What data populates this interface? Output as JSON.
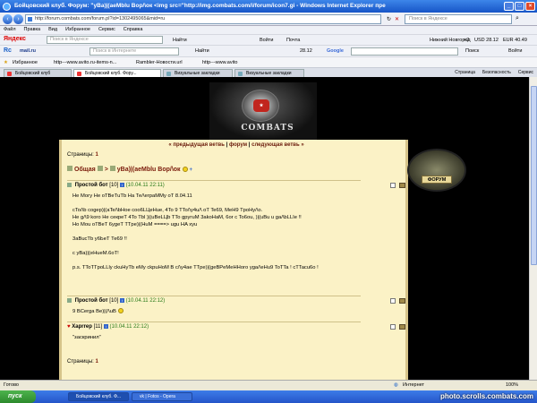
{
  "window": {
    "title": "Бойцовский клуб. Форум: \"уВа)|(аеМblu Вор/\\ок <img src=\"http://img.combats.com/i/forum/icon7.gi - Windows Internet Explorer пре"
  },
  "address": {
    "url": "http://forum.combats.com/forum.pl?id=1302495065&mid=ru",
    "search_placeholder": "Поиск в Яндексе"
  },
  "menu": [
    "Файл",
    "Правка",
    "Вид",
    "Избранное",
    "Сервис",
    "Справка"
  ],
  "toolbar1": {
    "brand": "Яндекс",
    "search_placeholder": "Поиск в Яндексе",
    "find": "Найти",
    "login": "Войти",
    "mail": "Почта",
    "city": "Нижний Новгород",
    "temp": "+2",
    "usd": "USD 28.12",
    "eur": "EUR 40.49"
  },
  "toolbar2": {
    "brand": "Rc",
    "mail_domain": "mail.ru",
    "search_placeholder": "Поиск в Интернете",
    "find": "Найти",
    "rate": "28.12",
    "google": "Google",
    "search": "Поиск",
    "login": "Войти"
  },
  "toolbar3": {
    "favorites": "Избранное",
    "fav1": "http---www.avito.ru-items-n...",
    "fav2": "Rambler-Новости.url",
    "fav3": "http---www.avito"
  },
  "tabs": [
    {
      "label": "Бойцовский клуб"
    },
    {
      "label": "Бойцовский клуб. Фору..."
    },
    {
      "label": "Визуальные закладки"
    },
    {
      "label": "Визуальные закладки"
    }
  ],
  "tab_tools": [
    "Страница",
    "Безопасность",
    "Сервис"
  ],
  "banner": {
    "text": "COMBATS"
  },
  "forum_badge": "ФОРУМ",
  "nav": {
    "prev": "« предыдущая ветвь",
    "forum": "форум",
    "next": "следующая ветвь »"
  },
  "pages_label": "Страницы:",
  "pages_value": "1",
  "breadcrumb": {
    "forum": "Общая",
    "sep": ">",
    "topic": "уВа)|(аеМblu Вор/\\ок"
  },
  "posts": [
    {
      "author": "Простой бот",
      "level": "[10]",
      "date": "(10.04.11 22:11)",
      "body": "Не Могу Не оТВеТuТb На Те/\\еграММу оТ 8.04.11\n\ncTo/\\b cogep)|(aTe/\\bHoe coo6LЦeHue, 4To 9 TTo/\\y4u/\\ oT Te69, MeH9 TpoHy/\\o.\nHe g/\\9 koro He ceкpeT 4To Tbl )|(uBeLЦb TTo gpyгuM 3akoHaM, 6or c To6ou, )|(uBu u ga/\\bLLIe !!\nHo Mou oTBeT 6ygeT TTpe)|(HuM ====> ugu HA xyu\n\n3aBucTb у6ЬеТ Те69 !!\n\nc уВа)|(eHueM.6oT!\n\np.s. TToTTpoLLly ckuHyTb eMy ckpuHoM B c/\\y4ae TTpe)|(geBPeMeHHoro yga/\\eHu9 ToTTa ! cTTacu6o !"
    },
    {
      "author": "Простой бот",
      "level": "[10]",
      "date": "(10.04.11 22:12)",
      "body": "9 BCerga Be)|(/\\uB"
    },
    {
      "author": "Харrrер",
      "level": "[11]",
      "date": "(10.04.11 22:12)",
      "body": "\"заскринил\""
    }
  ],
  "status": {
    "left": "Готово",
    "zone": "Интернет",
    "zoom": "100%"
  },
  "taskbar": {
    "start": "пуск",
    "tasks": [
      "Бойцовский клуб. Ф...",
      "vk | Fotos - Opera"
    ],
    "watermark": "photo.scrolls.combats.com"
  }
}
